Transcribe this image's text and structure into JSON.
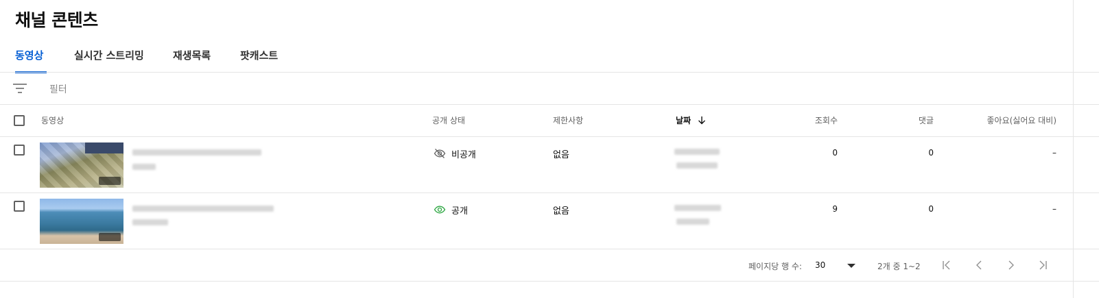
{
  "page_title": "채널 콘텐츠",
  "tabs": [
    {
      "label": "동영상",
      "active": true
    },
    {
      "label": "실시간 스트리밍",
      "active": false
    },
    {
      "label": "재생목록",
      "active": false
    },
    {
      "label": "팟캐스트",
      "active": false
    }
  ],
  "filter": {
    "icon": "filter-icon",
    "label": "필터"
  },
  "columns": {
    "video": "동영상",
    "visibility": "공개 상태",
    "restrictions": "제한사항",
    "date": "날짜",
    "views": "조회수",
    "comments": "댓글",
    "likes": "좋아요(싫어요 대비)"
  },
  "sort": {
    "column": "date",
    "direction": "descending",
    "icon": "arrow-down-icon"
  },
  "rows": [
    {
      "visibility": "비공개",
      "visibility_icon": "eye-off-icon",
      "visibility_color": "#606060",
      "restrictions": "없음",
      "views": "0",
      "comments": "0",
      "likes": "–",
      "thumbnail_colors": [
        "#7f9cd0",
        "#8b8a5e",
        "#c7c6a8"
      ]
    },
    {
      "visibility": "공개",
      "visibility_icon": "eye-icon",
      "visibility_color": "#2ba640",
      "restrictions": "없음",
      "views": "9",
      "comments": "0",
      "likes": "–",
      "thumbnail_colors": [
        "#8fb8e8",
        "#3b7aa0",
        "#d8c3a8"
      ]
    }
  ],
  "pagination": {
    "rows_per_page_label": "페이지당 행 수:",
    "rows_per_page": "30",
    "range": "2개 중 1~2",
    "icons": [
      "first-page-icon",
      "prev-page-icon",
      "next-page-icon",
      "last-page-icon"
    ]
  },
  "colors": {
    "accent": "#065fd4",
    "public_green": "#2ba640"
  }
}
